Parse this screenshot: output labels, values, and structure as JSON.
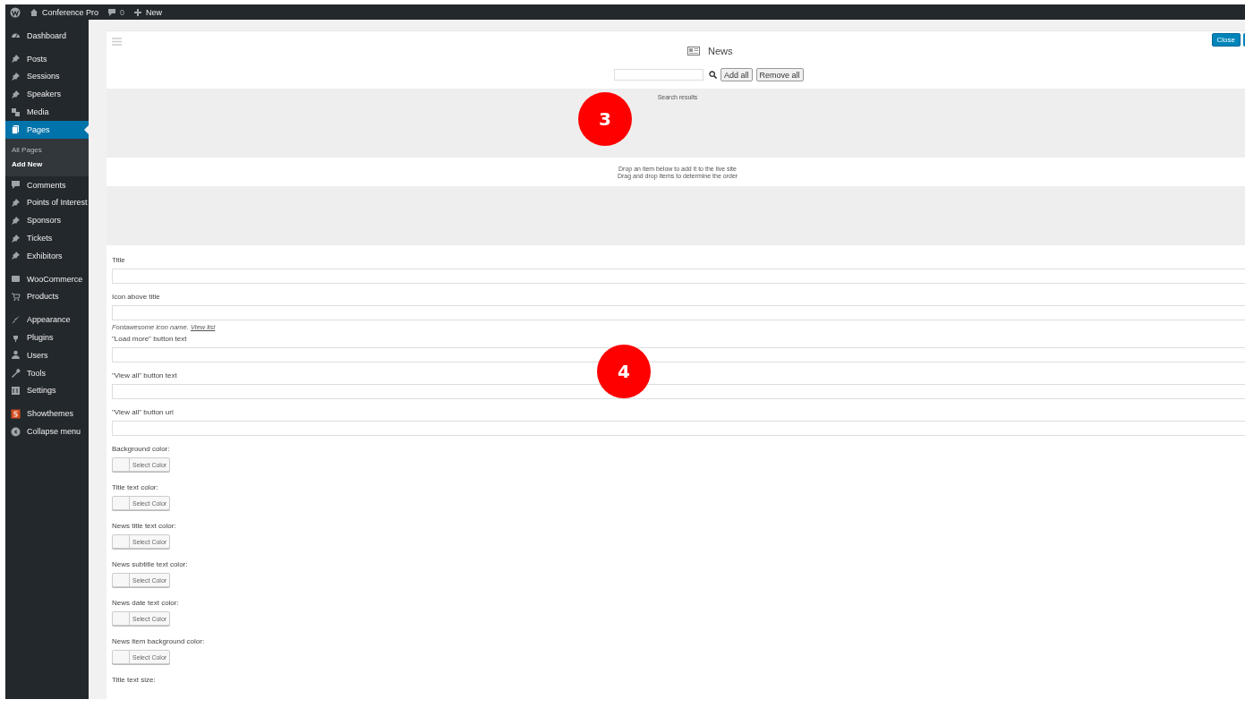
{
  "admin_bar": {
    "site_name": "Conference Pro",
    "comments_count": "0",
    "new_label": "New"
  },
  "sidebar": {
    "groups": [
      [
        {
          "label": "Dashboard",
          "selected": false
        }
      ],
      [
        {
          "label": "Posts",
          "selected": false
        },
        {
          "label": "Sessions",
          "selected": false
        },
        {
          "label": "Speakers",
          "selected": false
        },
        {
          "label": "Media",
          "selected": false
        },
        {
          "label": "Pages",
          "selected": true,
          "children": [
            {
              "label": "All Pages",
              "selected": false
            },
            {
              "label": "Add New",
              "selected": true
            }
          ]
        },
        {
          "label": "Comments",
          "selected": false
        },
        {
          "label": "Points of Interest",
          "selected": false
        },
        {
          "label": "Sponsors",
          "selected": false
        },
        {
          "label": "Tickets",
          "selected": false
        },
        {
          "label": "Exhibitors",
          "selected": false
        }
      ],
      [
        {
          "label": "WooCommerce",
          "selected": false
        },
        {
          "label": "Products",
          "selected": false
        }
      ],
      [
        {
          "label": "Appearance",
          "selected": false
        },
        {
          "label": "Plugins",
          "selected": false
        },
        {
          "label": "Users",
          "selected": false
        },
        {
          "label": "Tools",
          "selected": false
        },
        {
          "label": "Settings",
          "selected": false
        }
      ],
      [
        {
          "label": "Showthemes",
          "selected": false
        },
        {
          "label": "Collapse menu",
          "selected": false
        }
      ]
    ]
  },
  "panel": {
    "title": "News",
    "close_label": "Close",
    "add_all": "Add all",
    "remove_all": "Remove all",
    "results_label": "Search results",
    "drop_hint": [
      "Drop an item below to add it to the live site",
      "Drag and drop items to determine the order"
    ],
    "fields": [
      {
        "kind": "text",
        "label": "Title"
      },
      {
        "kind": "text",
        "label": "Icon above title",
        "hint": "Fontawesome icon name.",
        "hint_link": "View list"
      },
      {
        "kind": "text",
        "label": "\"Load more\" button text"
      },
      {
        "kind": "text",
        "label": "\"View all\" button text"
      },
      {
        "kind": "text",
        "label": "\"View all\" button url"
      },
      {
        "kind": "color",
        "label": "Background color:",
        "button": "Select Color"
      },
      {
        "kind": "color",
        "label": "Title text color:",
        "button": "Select Color"
      },
      {
        "kind": "color",
        "label": "News title text color:",
        "button": "Select Color"
      },
      {
        "kind": "color",
        "label": "News subtitle text color:",
        "button": "Select Color"
      },
      {
        "kind": "color",
        "label": "News date text color:",
        "button": "Select Color"
      },
      {
        "kind": "color",
        "label": "News item background color:",
        "button": "Select Color"
      },
      {
        "kind": "heading",
        "label": "Title text size:"
      }
    ]
  },
  "callouts": [
    {
      "number": "3"
    },
    {
      "number": "4"
    }
  ]
}
